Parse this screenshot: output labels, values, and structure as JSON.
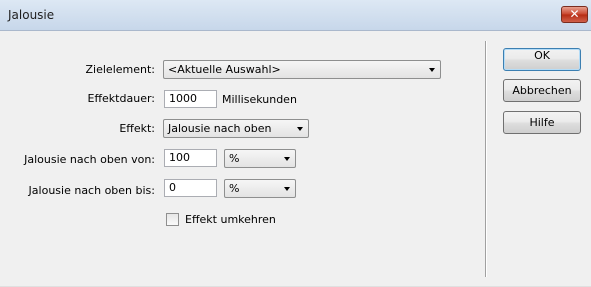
{
  "window": {
    "title": "Jalousie",
    "close_glyph": "✕"
  },
  "form": {
    "target_label": "Zielelement:",
    "target_value": "<Aktuelle Auswahl>",
    "duration_label": "Effektdauer:",
    "duration_value": "1000",
    "duration_unit": "Millisekunden",
    "effect_label": "Effekt:",
    "effect_value": "Jalousie nach oben",
    "from_label": "Jalousie nach oben von:",
    "from_value": "100",
    "from_unit": "%",
    "to_label": "Jalousie nach oben bis:",
    "to_value": "0",
    "to_unit": "%",
    "reverse_label": "Effekt umkehren",
    "reverse_checked": false
  },
  "buttons": {
    "ok": "OK",
    "cancel": "Abbrechen",
    "help": "Hilfe"
  },
  "icons": {
    "close": "close-icon",
    "dropdown": "chevron-down-icon",
    "checkbox": "checkbox-icon"
  }
}
